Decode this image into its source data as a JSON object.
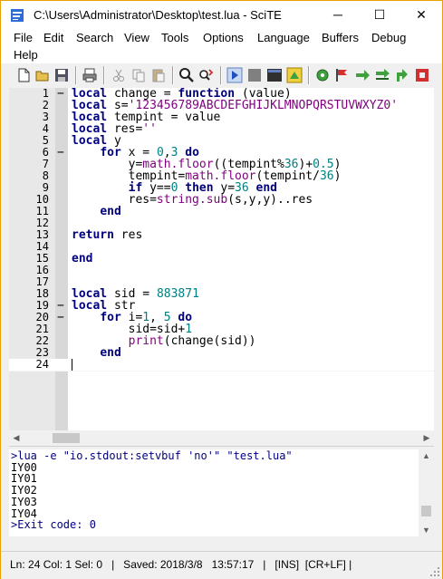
{
  "window": {
    "title": "C:\\Users\\Administrator\\Desktop\\test.lua - SciTE",
    "minimize_glyph": "─",
    "maximize_glyph": "☐",
    "close_glyph": "✕"
  },
  "menu": {
    "items": [
      "File",
      "Edit",
      "Search",
      "View",
      "Tools",
      "Options",
      "Language",
      "Buffers",
      "Debug",
      "Help"
    ]
  },
  "toolbar": {
    "icons": [
      "new-file-icon",
      "open-file-icon",
      "save-icon",
      "print-icon",
      "cut-icon",
      "copy-icon",
      "paste-icon",
      "find-icon",
      "replace-icon",
      "run-icon",
      "stop-icon",
      "console-icon",
      "compile-icon",
      "settings-icon",
      "bookmark-flag-icon",
      "step-next-icon",
      "step-over-icon",
      "step-out-icon",
      "debug-red-icon"
    ]
  },
  "editor": {
    "line_numbers": [
      "1",
      "2",
      "3",
      "4",
      "5",
      "6",
      "7",
      "8",
      "9",
      "10",
      "11",
      "12",
      "13",
      "14",
      "15",
      "16",
      "17",
      "18",
      "19",
      "20",
      "21",
      "22",
      "23",
      "24"
    ],
    "fold_markers": [
      "−",
      "",
      "",
      "",
      "",
      "−",
      "",
      "",
      "",
      "",
      "",
      "",
      "",
      "",
      "",
      "",
      "",
      "",
      "−",
      "−",
      "",
      "",
      "",
      ""
    ],
    "lines": [
      [
        {
          "t": "kw",
          "v": "local"
        },
        {
          "t": "op",
          "v": " change = "
        },
        {
          "t": "kw",
          "v": "function"
        },
        {
          "t": "op",
          "v": " (value)"
        }
      ],
      [
        {
          "t": "kw",
          "v": "local"
        },
        {
          "t": "op",
          "v": " s="
        },
        {
          "t": "str",
          "v": "'123456789ABCDEFGHIJKLMNOPQRSTUVWXYZ0'"
        }
      ],
      [
        {
          "t": "kw",
          "v": "local"
        },
        {
          "t": "op",
          "v": " tempint = value"
        }
      ],
      [
        {
          "t": "kw",
          "v": "local"
        },
        {
          "t": "op",
          "v": " res="
        },
        {
          "t": "str",
          "v": "''"
        }
      ],
      [
        {
          "t": "kw",
          "v": "local"
        },
        {
          "t": "op",
          "v": " y"
        }
      ],
      [
        {
          "t": "op",
          "v": "    "
        },
        {
          "t": "kw",
          "v": "for"
        },
        {
          "t": "op",
          "v": " x = "
        },
        {
          "t": "num",
          "v": "0"
        },
        {
          "t": "op",
          "v": ","
        },
        {
          "t": "num",
          "v": "3"
        },
        {
          "t": "op",
          "v": " "
        },
        {
          "t": "kw",
          "v": "do"
        }
      ],
      [
        {
          "t": "op",
          "v": "        y="
        },
        {
          "t": "str",
          "v": "math.floor"
        },
        {
          "t": "op",
          "v": "((tempint%"
        },
        {
          "t": "num",
          "v": "36"
        },
        {
          "t": "op",
          "v": ")+"
        },
        {
          "t": "num",
          "v": "0.5"
        },
        {
          "t": "op",
          "v": ")"
        }
      ],
      [
        {
          "t": "op",
          "v": "        tempint="
        },
        {
          "t": "str",
          "v": "math.floor"
        },
        {
          "t": "op",
          "v": "(tempint/"
        },
        {
          "t": "num",
          "v": "36"
        },
        {
          "t": "op",
          "v": ")"
        }
      ],
      [
        {
          "t": "op",
          "v": "        "
        },
        {
          "t": "kw",
          "v": "if"
        },
        {
          "t": "op",
          "v": " y=="
        },
        {
          "t": "num",
          "v": "0"
        },
        {
          "t": "op",
          "v": " "
        },
        {
          "t": "kw",
          "v": "then"
        },
        {
          "t": "op",
          "v": " y="
        },
        {
          "t": "num",
          "v": "36"
        },
        {
          "t": "op",
          "v": " "
        },
        {
          "t": "kw",
          "v": "end"
        }
      ],
      [
        {
          "t": "op",
          "v": "        res="
        },
        {
          "t": "str",
          "v": "string.sub"
        },
        {
          "t": "op",
          "v": "(s,y,y)..res"
        }
      ],
      [
        {
          "t": "op",
          "v": "    "
        },
        {
          "t": "kw",
          "v": "end"
        }
      ],
      [],
      [
        {
          "t": "kw",
          "v": "return"
        },
        {
          "t": "op",
          "v": " res"
        }
      ],
      [],
      [
        {
          "t": "kw",
          "v": "end"
        }
      ],
      [],
      [],
      [
        {
          "t": "kw",
          "v": "local"
        },
        {
          "t": "op",
          "v": " sid = "
        },
        {
          "t": "num",
          "v": "883871"
        }
      ],
      [
        {
          "t": "kw",
          "v": "local"
        },
        {
          "t": "op",
          "v": " str"
        }
      ],
      [
        {
          "t": "op",
          "v": "    "
        },
        {
          "t": "kw",
          "v": "for"
        },
        {
          "t": "op",
          "v": " i="
        },
        {
          "t": "num",
          "v": "1"
        },
        {
          "t": "op",
          "v": ", "
        },
        {
          "t": "num",
          "v": "5"
        },
        {
          "t": "op",
          "v": " "
        },
        {
          "t": "kw",
          "v": "do"
        }
      ],
      [
        {
          "t": "op",
          "v": "        sid=sid+"
        },
        {
          "t": "num",
          "v": "1"
        }
      ],
      [
        {
          "t": "op",
          "v": "        "
        },
        {
          "t": "str",
          "v": "print"
        },
        {
          "t": "op",
          "v": "(change(sid))"
        }
      ],
      [
        {
          "t": "op",
          "v": "    "
        },
        {
          "t": "kw",
          "v": "end"
        }
      ],
      []
    ]
  },
  "output": {
    "lines": [
      {
        "text": ">lua -e \"io.stdout:setvbuf 'no'\" \"test.lua\"",
        "color": "#00007f"
      },
      {
        "text": "IY00",
        "color": "#000000"
      },
      {
        "text": "IY01",
        "color": "#000000"
      },
      {
        "text": "IY02",
        "color": "#000000"
      },
      {
        "text": "IY03",
        "color": "#000000"
      },
      {
        "text": "IY04",
        "color": "#000000"
      },
      {
        "text": ">Exit code: 0",
        "color": "#00007f"
      }
    ]
  },
  "statusbar": {
    "text": "Ln: 24 Col: 1 Sel: 0   |   Saved: 2018/3/8   13:57:17   |   [INS]  [CR+LF] |"
  },
  "colors": {
    "keyword": "#00007f",
    "string": "#7f007f",
    "number": "#007f7f",
    "window_border": "#e8a000"
  }
}
